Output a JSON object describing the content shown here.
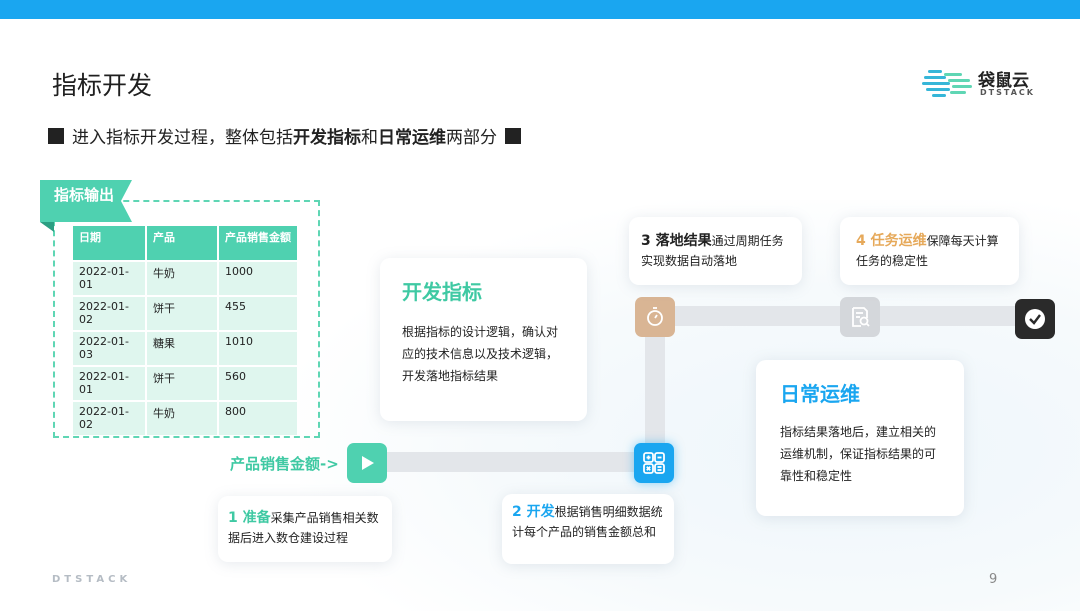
{
  "title": "指标开发",
  "logo": {
    "name": "袋鼠云",
    "sub": "DTSTACK"
  },
  "subtitle": {
    "pre": "进入指标开发过程，整体包括",
    "b1": "开发指标",
    "mid": "和",
    "b2": "日常运维",
    "post": "两部分"
  },
  "output": {
    "tag": "指标输出",
    "headers": [
      "日期",
      "产品",
      "产品销售金额"
    ],
    "rows": [
      [
        "2022-01-01",
        "牛奶",
        "1000"
      ],
      [
        "2022-01-02",
        "饼干",
        "455"
      ],
      [
        "2022-01-03",
        "糖果",
        "1010"
      ],
      [
        "2022-01-01",
        "饼干",
        "560"
      ],
      [
        "2022-01-02",
        "牛奶",
        "800"
      ]
    ]
  },
  "dev_card": {
    "title": "开发指标",
    "body": "根据指标的设计逻辑，确认对应的技术信息以及技术逻辑，开发落地指标结果"
  },
  "ops_card": {
    "title": "日常运维",
    "body": "指标结果落地后，建立相关的运维机制，保证指标结果的可靠性和稳定性"
  },
  "start_label": "产品销售金额->",
  "steps": {
    "s1": {
      "label": "1 准备",
      "text": "采集产品销售相关数据后进入数仓建设过程"
    },
    "s2": {
      "label": "2 开发",
      "text": "根据销售明细数据统计每个产品的销售金额总和"
    },
    "s3": {
      "label": "3 落地结果",
      "text": "通过周期任务实现数据自动落地"
    },
    "s4": {
      "label": "4 任务运维",
      "text": "保障每天计算任务的稳定性"
    }
  },
  "colors": {
    "accent_blue": "#1aa6f0",
    "accent_green": "#4fd1b0",
    "accent_orange": "#e6a95a",
    "dark": "#222222"
  },
  "icons": [
    "play-icon",
    "calculator-icon",
    "timer-icon",
    "search-doc-icon",
    "check-icon"
  ],
  "footer": {
    "brand": "DTSTACK",
    "page": "9"
  }
}
